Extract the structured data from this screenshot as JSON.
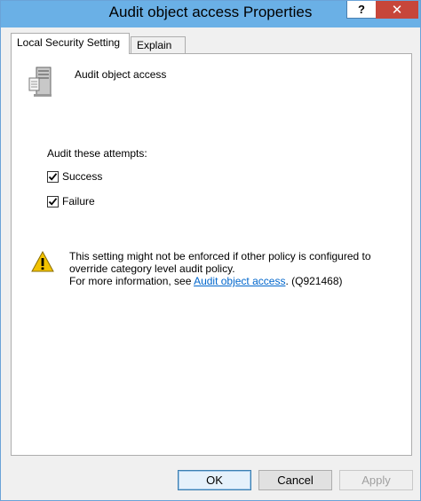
{
  "window": {
    "title": "Audit object access Properties"
  },
  "titlebar": {
    "help_label": "?",
    "close_label": "✕"
  },
  "tabs": [
    {
      "label": "Local Security Setting",
      "active": true
    },
    {
      "label": "Explain",
      "active": false
    }
  ],
  "policy": {
    "name": "Audit object access",
    "icon": "server-icon"
  },
  "audit": {
    "label": "Audit these attempts:",
    "options": [
      {
        "label": "Success",
        "checked": true
      },
      {
        "label": "Failure",
        "checked": true
      }
    ]
  },
  "warning": {
    "icon": "warning-icon",
    "line1": "This setting might not be enforced if other policy is configured to override category level audit policy.",
    "line2_prefix": "For more information, see ",
    "link_text": "Audit object access",
    "line2_suffix": ". (Q921468)"
  },
  "buttons": {
    "ok": "OK",
    "cancel": "Cancel",
    "apply": "Apply"
  },
  "colors": {
    "titlebar": "#6ab0e6",
    "close": "#c7463a",
    "link": "#0066cc"
  }
}
